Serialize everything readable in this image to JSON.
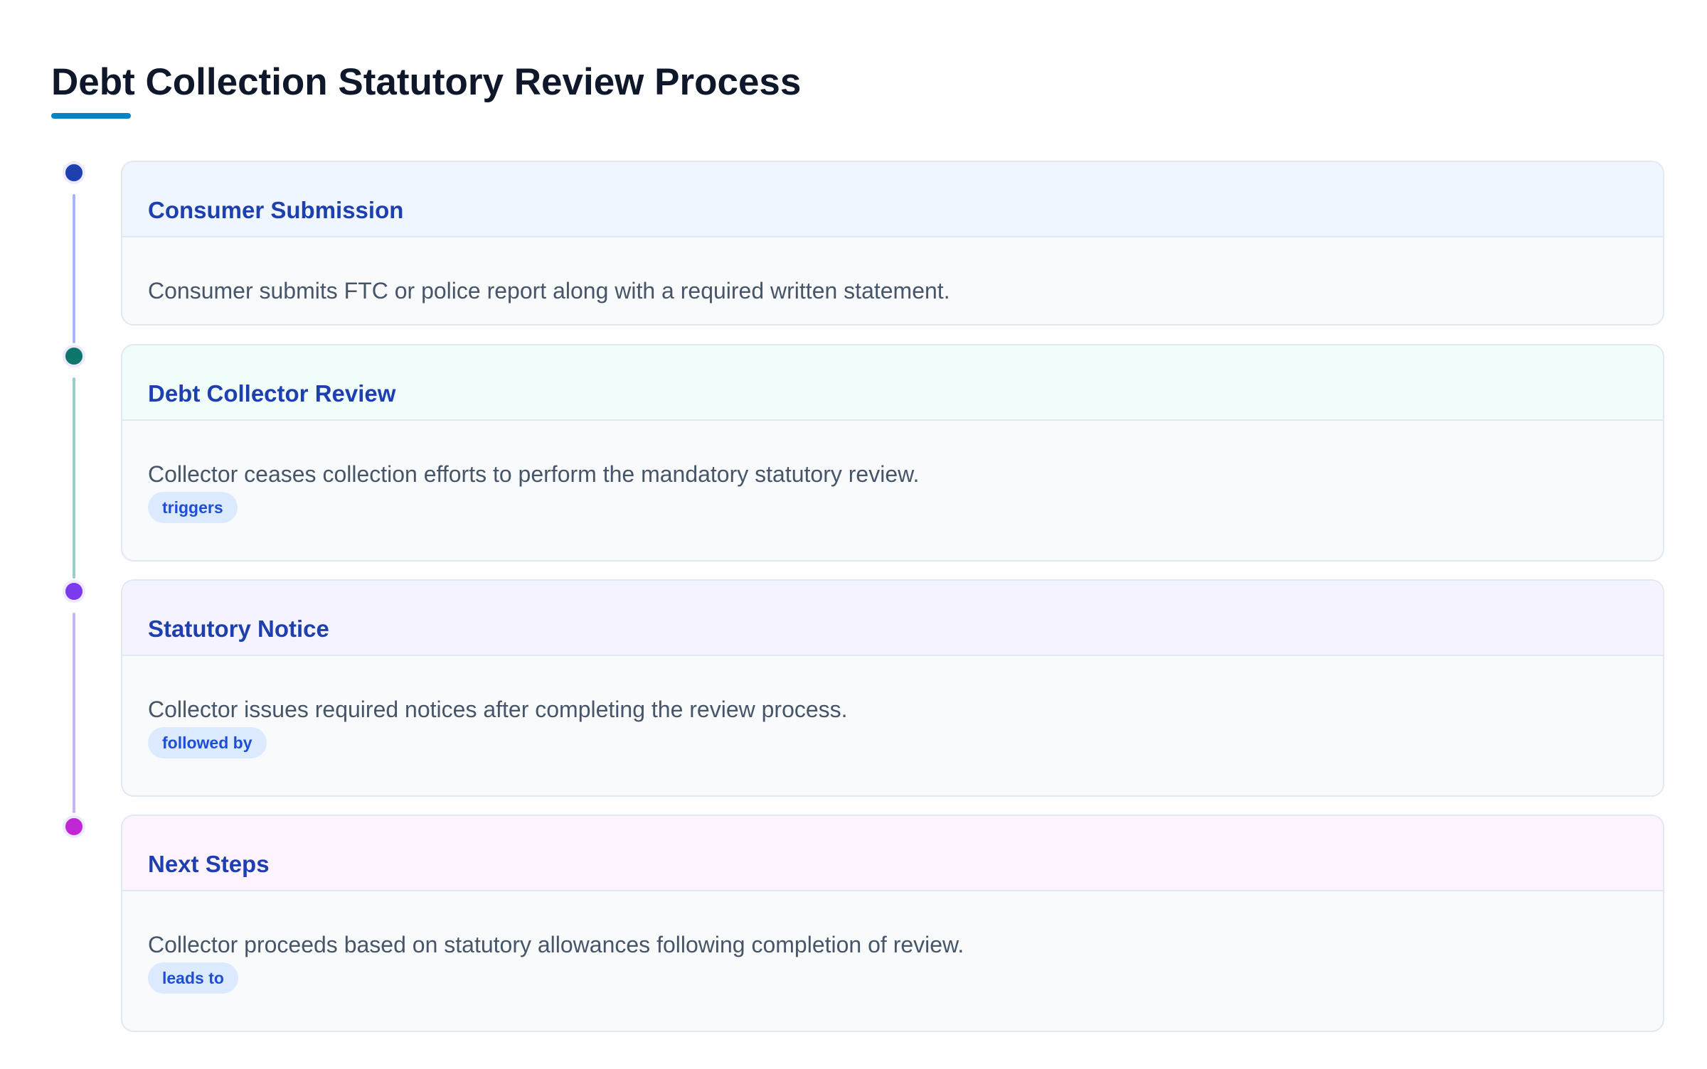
{
  "page": {
    "title": "Debt Collection Statutory Review Process"
  },
  "steps": [
    {
      "title": "Consumer Submission",
      "description": "Consumer submits FTC or police report along with a required written statement.",
      "tag": "",
      "dot_color": "#1e40af",
      "header_bg": "#eff6ff",
      "line_color": "#a5b4fc"
    },
    {
      "title": "Debt Collector Review",
      "description": "Collector ceases collection efforts to perform the mandatory statutory review.",
      "tag": "triggers",
      "dot_color": "#0f766e",
      "header_bg": "#f0fdfa",
      "line_color": "#99cfc7"
    },
    {
      "title": "Statutory Notice",
      "description": "Collector issues required notices after completing the review process.",
      "tag": "followed by",
      "dot_color": "#7c3aed",
      "header_bg": "#f5f3ff",
      "line_color": "#c4b5fd"
    },
    {
      "title": "Next Steps",
      "description": "Collector proceeds based on statutory allowances following completion of review.",
      "tag": "leads to",
      "dot_color": "#c026d3",
      "header_bg": "#fdf4ff",
      "line_color": ""
    }
  ]
}
